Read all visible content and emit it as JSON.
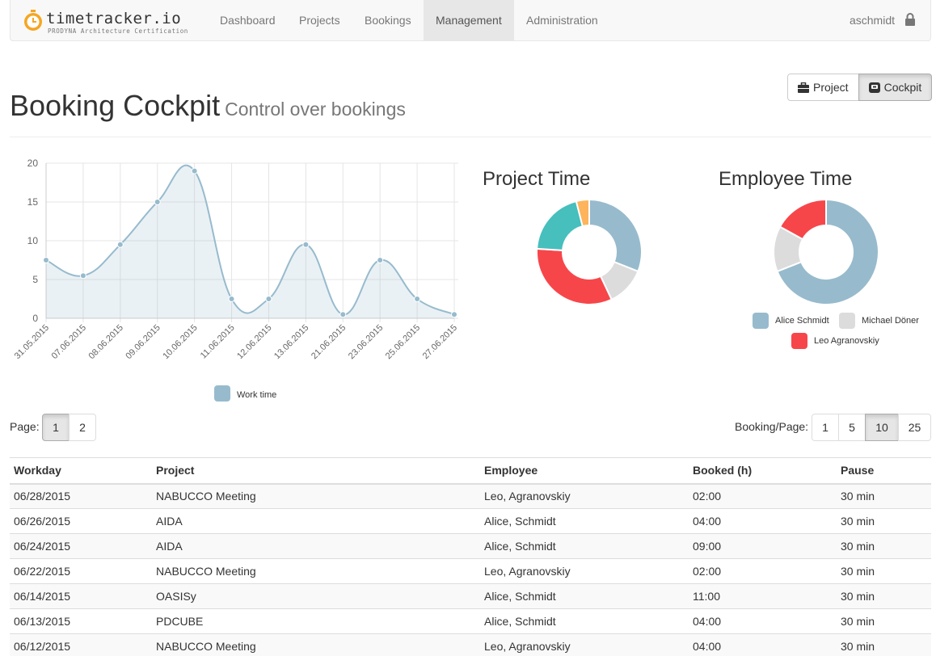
{
  "navbar": {
    "brand_title": "timetracker.io",
    "brand_subtitle": "PRODYNA Architecture Certification",
    "items": [
      {
        "label": "Dashboard"
      },
      {
        "label": "Projects"
      },
      {
        "label": "Bookings"
      },
      {
        "label": "Management",
        "active": true
      },
      {
        "label": "Administration"
      }
    ],
    "user": "aschmidt",
    "user_icon": "lock-icon"
  },
  "header": {
    "title": "Booking Cockpit",
    "subtitle": "Control over bookings",
    "view_toggle": [
      {
        "label": "Project",
        "icon": "briefcase-icon"
      },
      {
        "label": "Cockpit",
        "icon": "cockpit-icon",
        "active": true
      }
    ]
  },
  "chart_data": [
    {
      "type": "line",
      "x": [
        "31.05.2015",
        "07.06.2015",
        "08.06.2015",
        "09.06.2015",
        "10.06.2015",
        "11.06.2015",
        "12.06.2015",
        "13.06.2015",
        "21.06.2015",
        "23.06.2015",
        "25.06.2015",
        "27.06.2015"
      ],
      "series": [
        {
          "name": "Work time",
          "values": [
            7.5,
            5.5,
            9.5,
            15,
            19,
            2.5,
            2.5,
            9.5,
            0.5,
            7.5,
            2.5,
            0.5
          ]
        }
      ],
      "ylim": [
        0,
        20
      ],
      "yticks": [
        "0",
        "5",
        "10",
        "15",
        "20"
      ],
      "grid": true,
      "legend": "bottom",
      "color": "#97bbcd"
    },
    {
      "type": "pie",
      "title": "Project Time",
      "values": [
        31,
        12,
        33,
        20,
        4
      ],
      "colors": [
        "#97bbcd",
        "#dcdcdc",
        "#f7464a",
        "#46bfbd",
        "#fdb45c"
      ]
    },
    {
      "type": "pie",
      "title": "Employee Time",
      "categories": [
        "Alice Schmidt",
        "Michael Döner",
        "Leo Agranovskiy"
      ],
      "values": [
        69,
        14,
        17
      ],
      "colors": [
        "#97bbcd",
        "#dcdcdc",
        "#f7464a"
      ],
      "legend": "bottom"
    }
  ],
  "pagination": {
    "page_label": "Page:",
    "pages": [
      "1",
      "2"
    ],
    "active_page": "1",
    "per_page_label": "Booking/Page:",
    "per_page_options": [
      "1",
      "5",
      "10",
      "25"
    ],
    "active_per_page": "10"
  },
  "table": {
    "columns": [
      "Workday",
      "Project",
      "Employee",
      "Booked (h)",
      "Pause"
    ],
    "rows": [
      [
        "06/28/2015",
        "NABUCCO Meeting",
        "Leo, Agranovskiy",
        "02:00",
        "30 min"
      ],
      [
        "06/26/2015",
        "AIDA",
        "Alice, Schmidt",
        "04:00",
        "30 min"
      ],
      [
        "06/24/2015",
        "AIDA",
        "Alice, Schmidt",
        "09:00",
        "30 min"
      ],
      [
        "06/22/2015",
        "NABUCCO Meeting",
        "Leo, Agranovskiy",
        "02:00",
        "30 min"
      ],
      [
        "06/14/2015",
        "OASISy",
        "Alice, Schmidt",
        "11:00",
        "30 min"
      ],
      [
        "06/13/2015",
        "PDCUBE",
        "Alice, Schmidt",
        "04:00",
        "30 min"
      ],
      [
        "06/12/2015",
        "NABUCCO Meeting",
        "Leo, Agranovskiy",
        "04:00",
        "30 min"
      ]
    ]
  }
}
